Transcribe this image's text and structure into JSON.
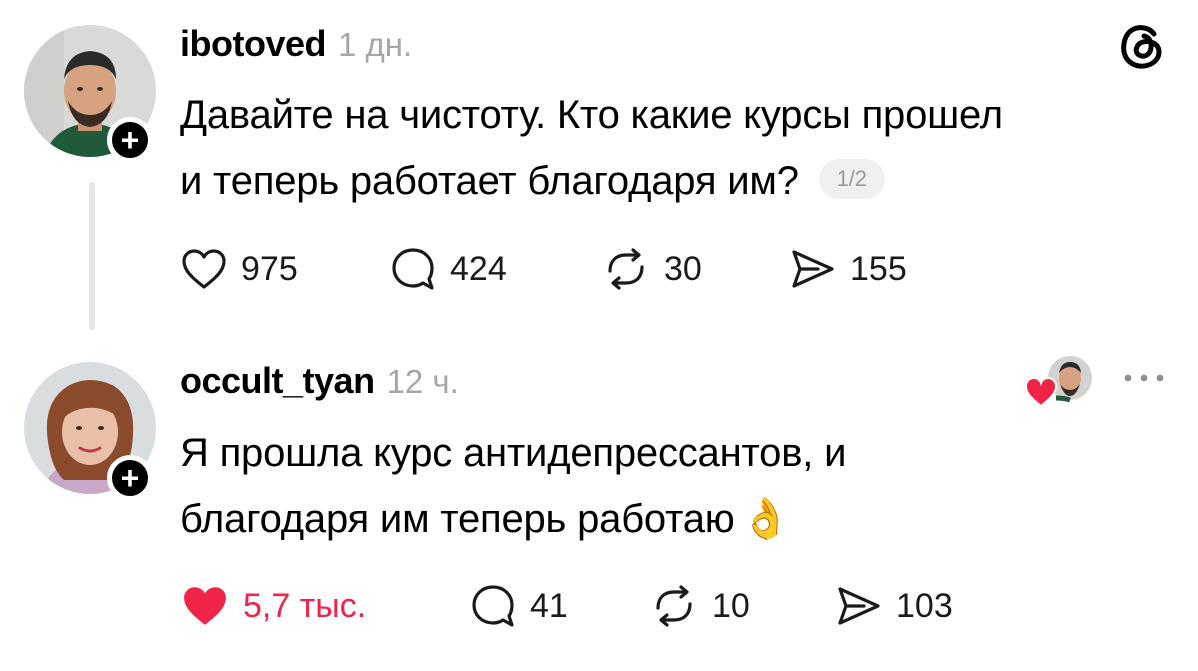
{
  "brand": {
    "logo_icon": "threads-logo-icon"
  },
  "colors": {
    "like_active": "#f02348",
    "thread_line": "#e6e6e6",
    "timestamp": "#a6a6a6"
  },
  "posts": [
    {
      "username": "ibotoved",
      "time": "1 дн.",
      "text_line1": "Давайте на чистоту. Кто какие курсы прошел",
      "text_line2": "и теперь работает благодаря им?",
      "pager": "1/2",
      "likes": "975",
      "comments": "424",
      "reposts": "30",
      "shares": "155",
      "liked": false
    },
    {
      "username": "occult_tyan",
      "time": "12 ч.",
      "text_line1": "Я прошла курс антидепрессантов, и",
      "text_line2": "благодаря им теперь работаю",
      "emoji": "👌",
      "likes": "5,7 тыс.",
      "comments": "41",
      "reposts": "10",
      "shares": "103",
      "liked": true
    }
  ]
}
